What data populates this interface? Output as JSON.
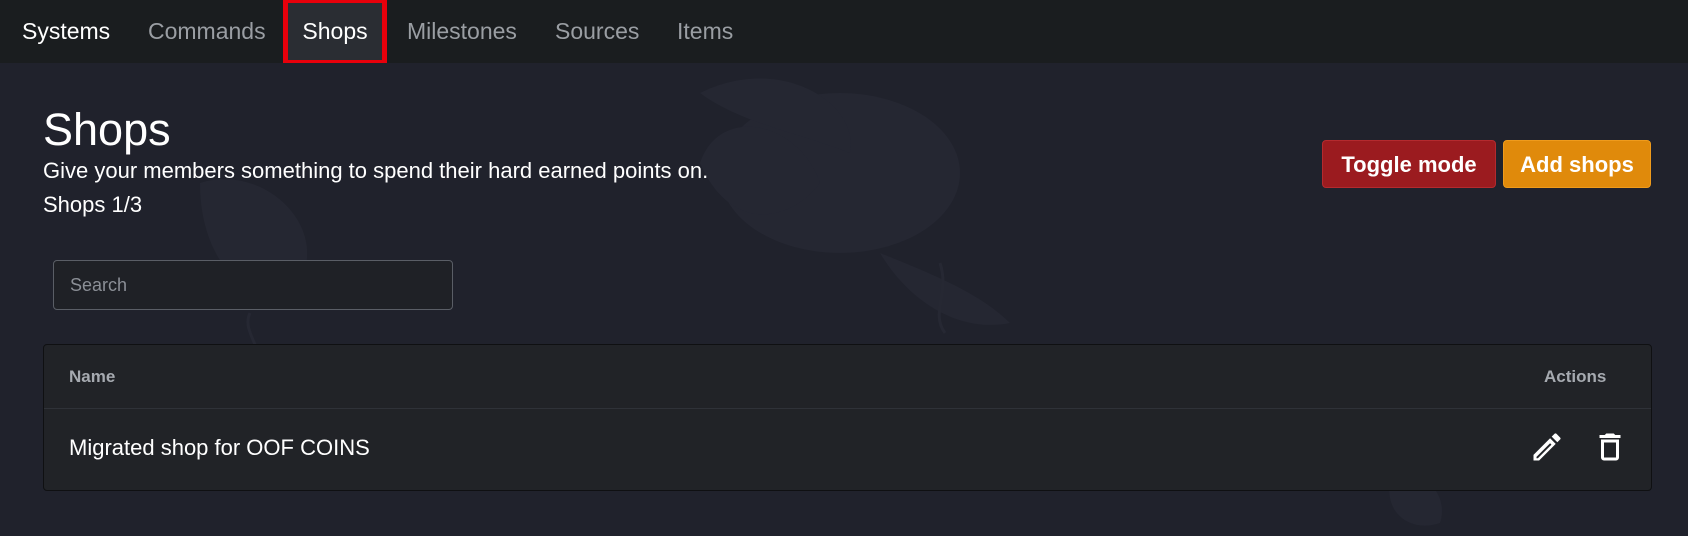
{
  "nav": {
    "items": [
      {
        "label": "Systems"
      },
      {
        "label": "Commands"
      },
      {
        "label": "Shops"
      },
      {
        "label": "Milestones"
      },
      {
        "label": "Sources"
      },
      {
        "label": "Items"
      }
    ],
    "current": "Shops"
  },
  "page": {
    "title": "Shops",
    "description": "Give your members something to spend their hard earned points on.",
    "count": "Shops 1/3"
  },
  "actions": {
    "toggle_label": "Toggle mode",
    "add_label": "Add shops"
  },
  "search": {
    "placeholder": "Search",
    "value": ""
  },
  "table": {
    "headers": {
      "name": "Name",
      "actions": "Actions"
    },
    "rows": [
      {
        "name": "Migrated shop for OOF COINS",
        "actions": [
          "pencil-icon",
          "trash-icon"
        ]
      }
    ]
  },
  "colors": {
    "nav_bg": "#1a1d1f",
    "page_bg": "#20222c",
    "toggle_button": "#9b1b1f",
    "add_button": "#e08a0b",
    "highlight_outline": "#e8000b"
  }
}
